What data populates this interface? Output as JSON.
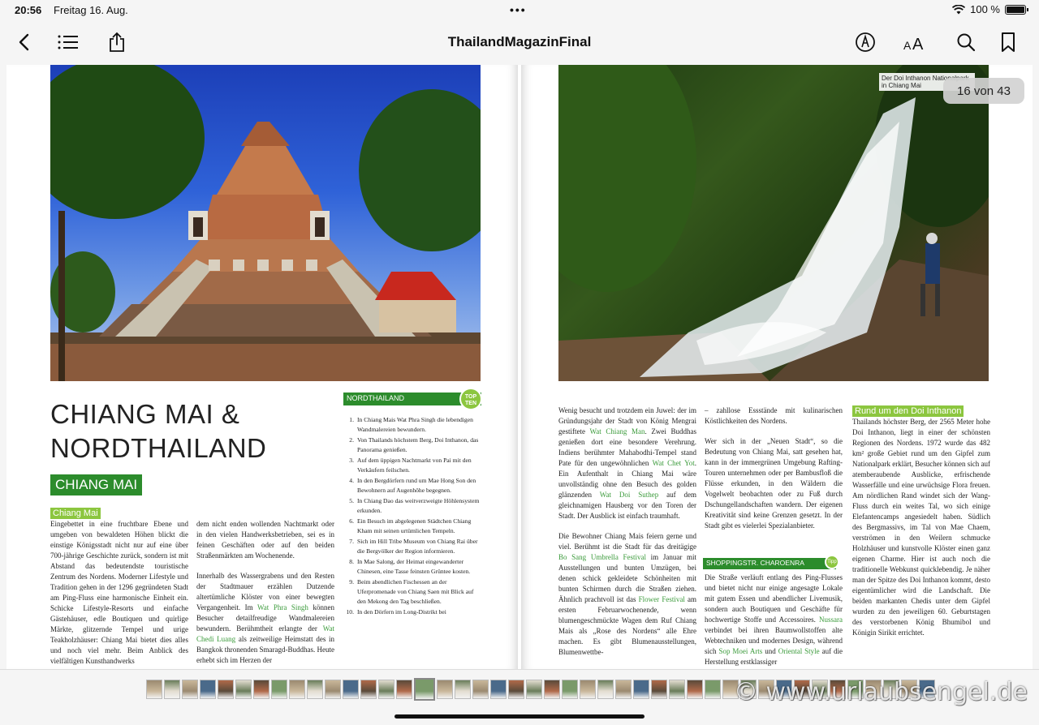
{
  "status_bar": {
    "time": "20:56",
    "date": "Freitag 16. Aug.",
    "dots": "•••",
    "battery": "100 %"
  },
  "toolbar": {
    "title": "ThailandMagazinFinal"
  },
  "page_counter": "16 von 43",
  "left_page": {
    "headline_line1": "CHIANG MAI &",
    "headline_line2": "NORDTHAILAND",
    "section_badge": "CHIANG MAI",
    "subhead": "Chiang Mai",
    "col1": [
      [
        "Eingebettet in eine fruchtbare Ebene und umgeben von bewaldeten Höhen blickt die einstige Königsstadt nicht nur auf eine über 700-jährige Geschichte zurück, sondern ist mit Abstand das bedeutendste touristische Zentrum des Nordens. Moderner Lifestyle und Tradition gehen in der 1296 gegründeten Stadt am Ping-Fluss eine harmonische Einheit ein. Schicke Lifestyle-Resorts und einfache Gästehäuser, edle Boutiquen und quirlige Märkte, glitzernde Tempel und urige Teakholzhäuser: Chiang Mai bietet dies alles und noch viel mehr. Beim Anblick des vielfältigen Kunsthandwerks"
      ]
    ],
    "col2_p1": "dem nicht enden wollenden Nachtmarkt oder in den vielen Handwerksbetrieben, sei es in feinen Geschäften oder auf den beiden Straßenmärkten am Wochenende.",
    "col2_p2_a": "Innerhalb des Wassergrabens und den Resten der Stadtmauer erzählen Dutzende altertümliche Klöster von einer bewegten Vergangenheit. Im ",
    "col2_p2_hl1": "Wat Phra Singh",
    "col2_p2_b": " können Besucher detailfreudige Wandmalereien bewundern. Berühmtheit erlangte der ",
    "col2_p2_hl2": "Wat Chedi Luang",
    "col2_p2_c": " als zeitweilige Heimstatt des in Bangkok thronenden Smaragd-Buddhas. Heute erhebt sich im Herzen der",
    "box_title": "NORDTHAILAND",
    "box_badge_1": "TOP",
    "box_badge_2": "TEN",
    "top_ten": [
      {
        "n": "1.",
        "text": "In Chiang Mais Wat Phra Singh die lebendigen Wandmalereien bewundern."
      },
      {
        "n": "2.",
        "text": "Von Thailands höchstem Berg, Doi Inthanon, das Panorama genießen."
      },
      {
        "n": "3.",
        "text": "Auf dem üppigen Nachtmarkt von Pai mit den Verkäufern feilschen."
      },
      {
        "n": "4.",
        "text": "In den Bergdörfern rund um Mae Hong Son den Bewohnern auf Augenhöhe begegnen."
      },
      {
        "n": "5.",
        "text": "In Chiang Dao das weitverzweigte Höhlensystem erkunden."
      },
      {
        "n": "6.",
        "text": "Ein Besuch im abgelegenen Städtchen Chiang Kham mit seinen urtümlichen Tempeln."
      },
      {
        "n": "7.",
        "text": "Sich im Hill Tribe Museum von Chiang Rai über die Bergvölker der Region informieren."
      },
      {
        "n": "8.",
        "text": "In Mae Salong, der Heimat eingewanderter Chinesen, eine Tasse feinsten Grüntee kosten."
      },
      {
        "n": "9.",
        "text": "Beim abendlichen Fischessen an der Uferpromenade von Chiang Saen mit Blick auf den Mekong den Tag beschließen."
      },
      {
        "n": "10.",
        "text": "In den Dörfern im Long-Distrikt bei"
      }
    ]
  },
  "right_page": {
    "photo_caption": "Der Doi Inthanon Nationalpark in Chiang Mai",
    "col1_p1_a": "Wenig besucht und trotzdem ein Juwel: der im Gründungsjahr der Stadt von König Mengrai gestiftete ",
    "col1_p1_hl1": "Wat Chiang Man",
    "col1_p1_b": ". Zwei Buddhas genießen dort eine besondere Verehrung. Indiens berühmter Mahabodhi-Tempel stand Pate für den ungewöhnlichen ",
    "col1_p1_hl2": "Wat Chet Yot",
    "col1_p1_c": ". Ein Aufenthalt in Chiang Mai wäre unvollständig ohne den Besuch des golden glänzenden ",
    "col1_p1_hl3": "Wat Doi Suthep",
    "col1_p1_d": " auf dem gleichnamigen Hausberg vor den Toren der Stadt. Der Ausblick ist einfach traumhaft.",
    "col1_p2_a": "Die Bewohner Chiang Mais feiern gerne und viel. Berühmt ist die Stadt für das dreitägige ",
    "col1_p2_hl1": "Bo Sang Umbrella Festival",
    "col1_p2_b": " im Januar mit Ausstellungen und bunten Umzügen, bei denen schick gekleidete Schönheiten mit bunten Schirmen durch die Straßen ziehen. Ähnlich prachtvoll ist das ",
    "col1_p2_hl2": "Flower Festival",
    "col1_p2_c": " am ersten Februarwochenende, wenn blumengeschmückte Wagen dem Ruf Chiang Mais als „Rose des Nordens“ alle Ehre machen. Es gibt Blumenausstellungen, Blumenwettbe-",
    "col2_p1": "– zahllose Essstände mit kulinarischen Köstlichkeiten des Nordens.",
    "col2_p2": "Wer sich in der „Neuen Stadt“, so die Bedeutung von Chiang Mai, satt gesehen hat, kann in der immergrünen Umgebung Rafting-Touren unternehmen oder per Bambusfloß die Flüsse erkunden, in den Wäldern die Vogelwelt beobachten oder zu Fuß durch Dschungellandschaften wandern. Der eigenen Kreativität sind keine Grenzen gesetzt. In der Stadt gibt es vielerlei Spezialanbieter.",
    "shop_title": "SHOPPINGSTR. CHAROENRA",
    "shop_badge": "Tipp",
    "col2_p3_a": "Die Straße verläuft entlang des Ping-Flusses und bietet nicht nur einige angesagte Lokale mit gutem Essen und abendlicher Livemusik, sondern auch Boutiquen und Geschäfte für hochwertige Stoffe und Accessoires. ",
    "col2_p3_hl1": "Nussara",
    "col2_p3_b": " verbindet bei ihren Baumwollstoffen alte Webtechniken und modernes Design, während sich ",
    "col2_p3_hl2": "Sop Moei Arts",
    "col2_p3_c": " und ",
    "col2_p3_hl3": "Oriental Style",
    "col2_p3_d": " auf die Herstellung erstklassiger",
    "subhead": "Rund um den Doi Inthanon",
    "col3": "Thailands höchster Berg, der 2565 Meter hohe Doi Inthanon, liegt in einer der schönsten Regionen des Nordens. 1972 wurde das 482 km² große Gebiet rund um den Gipfel zum Nationalpark erklärt, Besucher können sich auf atemberaubende Ausblicke, erfrischende Wasserfälle und eine urwüchsige Flora freuen. Am nördlichen Rand windet sich der Wang-Fluss durch ein weites Tal, wo sich einige Elefantencamps angesiedelt haben. Südlich des Bergmassivs, im Tal von Mae Chaem, verströmen in den Weilern schmucke Holzhäuser und kunstvolle Klöster einen ganz eigenen Charme. Hier ist auch noch die traditionelle Webkunst quicklebendig. Je näher man der Spitze des Doi Inthanon kommt, desto eigentümlicher wird die Landschaft. Die beiden markanten Chedis unter dem Gipfel wurden zu den jeweiligen 60. Geburtstagen des verstorbenen König Bhumibol und Königin Sirikit errichtet."
  },
  "watermark": "© www.urlaubsengel.de",
  "colors": {
    "accent_green": "#2c8c2c",
    "light_green": "#8cc63f",
    "highlight_text": "#3a9a3a"
  },
  "icons": [
    "back-chevron-icon",
    "list-icon",
    "share-icon",
    "markup-pen-icon",
    "text-size-icon",
    "search-icon",
    "bookmark-icon",
    "wifi-icon",
    "battery-icon"
  ]
}
